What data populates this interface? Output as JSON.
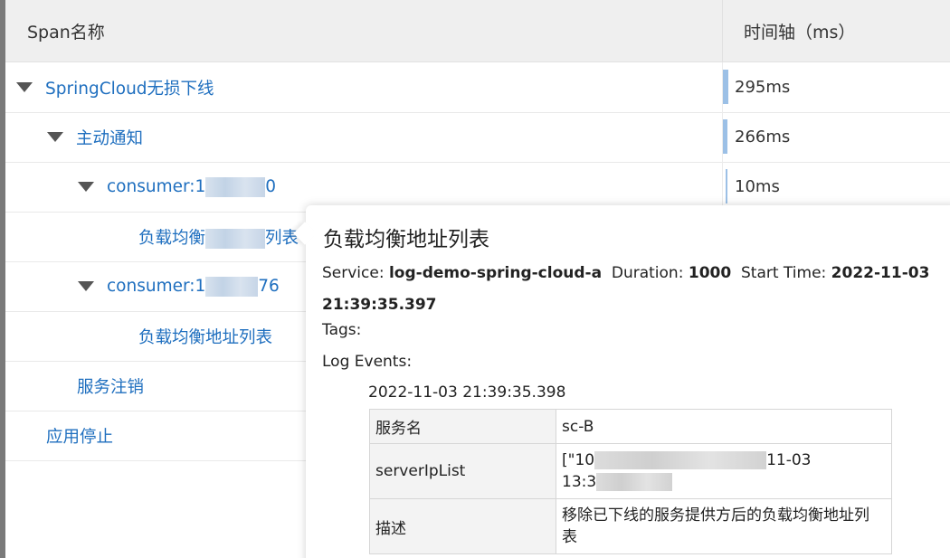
{
  "header": {
    "span_col": "Span名称",
    "time_col": "时间轴（ms）"
  },
  "rows": [
    {
      "name_prefix": "SpringCloud无损下线",
      "name_suffix": "",
      "masked": false,
      "expanded": true,
      "duration": "295ms",
      "bar_fraction": 1.0
    },
    {
      "name_prefix": "主动通知",
      "name_suffix": "",
      "masked": false,
      "expanded": true,
      "duration": "266ms",
      "bar_fraction": 0.9
    },
    {
      "name_prefix": "consumer:1",
      "name_suffix": "0",
      "masked": true,
      "expanded": true,
      "duration": "10ms",
      "bar_fraction": 0.034
    },
    {
      "name_prefix": "负载均衡",
      "name_suffix": "列表",
      "masked": true,
      "expanded": false
    },
    {
      "name_prefix": "consumer:1",
      "name_suffix": "76",
      "masked": true,
      "expanded": true
    },
    {
      "name_prefix": "负载均衡地址列表",
      "name_suffix": "",
      "masked": false,
      "expanded": false
    },
    {
      "name_prefix": "服务注销",
      "name_suffix": "",
      "masked": false,
      "expanded": false
    },
    {
      "name_prefix": "应用停止",
      "name_suffix": "",
      "masked": false,
      "expanded": false
    }
  ],
  "popover": {
    "title": "负载均衡地址列表",
    "service_label": "Service:",
    "service_value": "log-demo-spring-cloud-a",
    "duration_label": "Duration:",
    "duration_value": "1000",
    "start_label": "Start Time:",
    "start_value": "2022-11-03 21:39:35.397",
    "tags_label": "Tags:",
    "log_events_label": "Log Events:",
    "event_timestamp": "2022-11-03 21:39:35.398",
    "table": [
      {
        "key": "服务名",
        "value_a": "sc-B",
        "value_b": ""
      },
      {
        "key": "serverIpList",
        "value_a": "[\"10",
        "value_b": "11-03",
        "value_c": "13:3"
      },
      {
        "key": "描述",
        "value_a": "移除已下线的服务提供方后的负载均衡地址列表",
        "value_b": ""
      }
    ]
  }
}
